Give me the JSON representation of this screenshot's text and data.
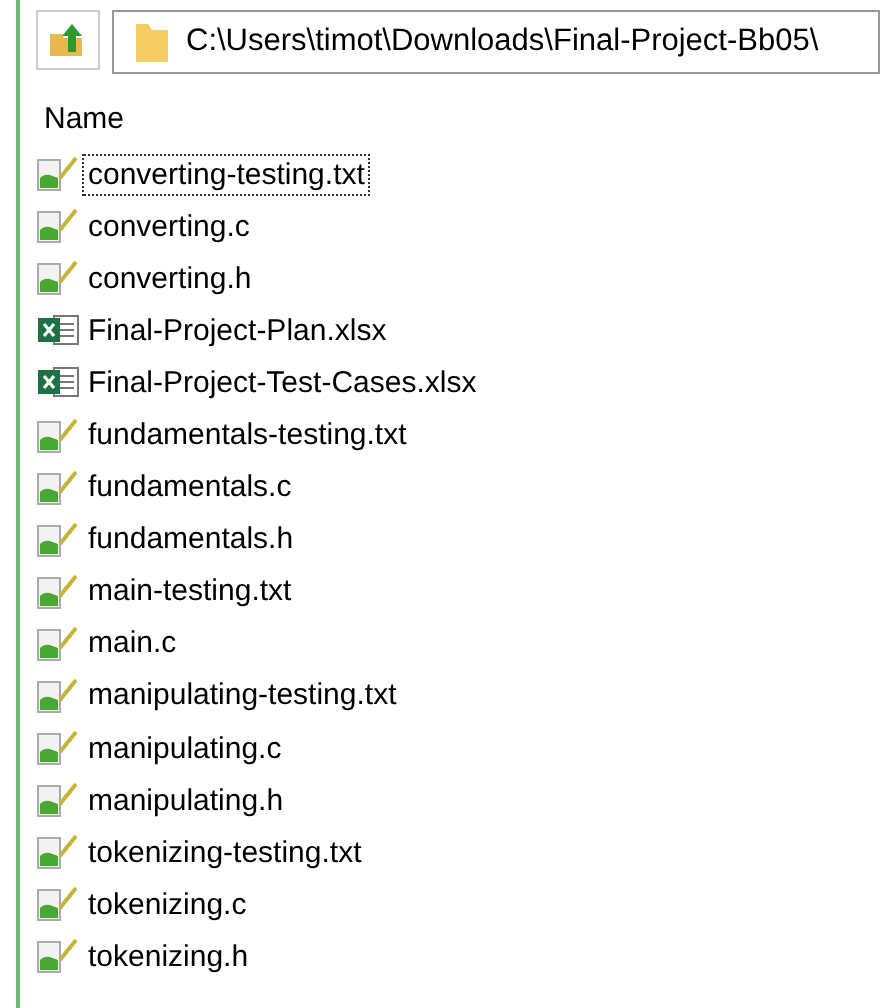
{
  "toolbar": {
    "path": "C:\\Users\\timot\\Downloads\\Final-Project-Bb05\\"
  },
  "list": {
    "column": "Name",
    "items": [
      {
        "name": "converting-testing.txt",
        "kind": "text",
        "focused": true
      },
      {
        "name": "converting.c",
        "kind": "text",
        "focused": false
      },
      {
        "name": "converting.h",
        "kind": "text",
        "focused": false
      },
      {
        "name": "Final-Project-Plan.xlsx",
        "kind": "excel",
        "focused": false
      },
      {
        "name": "Final-Project-Test-Cases.xlsx",
        "kind": "excel",
        "focused": false
      },
      {
        "name": "fundamentals-testing.txt",
        "kind": "text",
        "focused": false
      },
      {
        "name": "fundamentals.c",
        "kind": "text",
        "focused": false
      },
      {
        "name": "fundamentals.h",
        "kind": "text",
        "focused": false
      },
      {
        "name": "main-testing.txt",
        "kind": "text",
        "focused": false
      },
      {
        "name": "main.c",
        "kind": "text",
        "focused": false
      },
      {
        "name": "manipulating-testing.txt",
        "kind": "text",
        "focused": false
      },
      {
        "name": "manipulating.c",
        "kind": "text",
        "focused": false
      },
      {
        "name": "manipulating.h",
        "kind": "text",
        "focused": false
      },
      {
        "name": "tokenizing-testing.txt",
        "kind": "text",
        "focused": false
      },
      {
        "name": "tokenizing.c",
        "kind": "text",
        "focused": false
      },
      {
        "name": "tokenizing.h",
        "kind": "text",
        "focused": false
      }
    ]
  }
}
